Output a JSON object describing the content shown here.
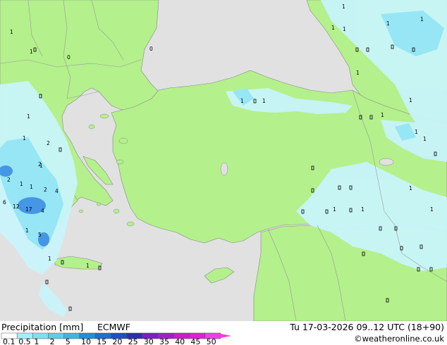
{
  "footer": {
    "title": "Precipitation [mm]",
    "model": "ECMWF",
    "datetime": "Tu 17-03-2026 09..12 UTC (18+90)",
    "credit": "©weatheronline.co.uk"
  },
  "legend": {
    "ticks": [
      "0.1",
      "0.5",
      "1",
      "2",
      "5",
      "10",
      "15",
      "20",
      "25",
      "30",
      "35",
      "40",
      "45",
      "50"
    ],
    "colors": [
      "#ffffff",
      "#9ff0f8",
      "#7fe0f0",
      "#5fcde8",
      "#3fb5e0",
      "#1f8fd8",
      "#1f6fd0",
      "#1f4fc8",
      "#2a2fb0",
      "#7a1fc8",
      "#a01fc8",
      "#c81fc8",
      "#e01fd8",
      "#f03ce8"
    ]
  },
  "colors": {
    "land": "#b4f08c",
    "sea": "#e1e1e1",
    "border": "#999999",
    "coast": "#888888",
    "precip_light": "#c8f4fa",
    "precip_mid": "#96e6f5",
    "precip_heavy": "#4696e6"
  },
  "map_labels": [
    "1",
    "1",
    "1",
    "1",
    "1",
    "1",
    "1",
    "1",
    "1",
    "1",
    "1",
    "1",
    "1",
    "1",
    "1",
    "1",
    "1",
    "1",
    "1",
    "1",
    "2",
    "2",
    "2",
    "2",
    "4",
    "4",
    "5",
    "6",
    "12",
    "17",
    "1",
    "1",
    "1",
    "1",
    "0",
    "0",
    "1",
    "1"
  ]
}
